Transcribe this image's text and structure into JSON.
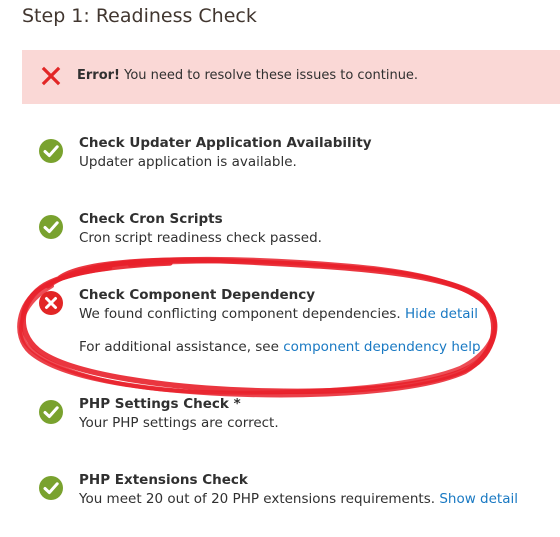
{
  "page": {
    "title": "Step 1: Readiness Check"
  },
  "error_banner": {
    "icon": "x-icon",
    "strong": "Error!",
    "message": "You need to resolve these issues to continue."
  },
  "checks": [
    {
      "status": "ok",
      "title": "Check Updater Application Availability",
      "description": "Updater application is available."
    },
    {
      "status": "ok",
      "title": "Check Cron Scripts",
      "description": "Cron script readiness check passed."
    },
    {
      "status": "error",
      "title": "Check Component Dependency",
      "description": "We found conflicting component dependencies.",
      "detail_link": "Hide detail",
      "help_prefix": "For additional assistance, see",
      "help_link": "component dependency help",
      "help_suffix": "."
    },
    {
      "status": "ok",
      "title": "PHP Settings Check *",
      "description": "Your PHP settings are correct."
    },
    {
      "status": "ok",
      "title": "PHP Extensions Check",
      "description": "You meet 20 out of 20 PHP extensions requirements.",
      "detail_link": "Show detail"
    }
  ],
  "colors": {
    "success": "#79a22e",
    "error": "#e22626",
    "error_banner_bg": "#fad8d6",
    "link": "#1979c3",
    "annotation_marker": "#e8202a"
  }
}
